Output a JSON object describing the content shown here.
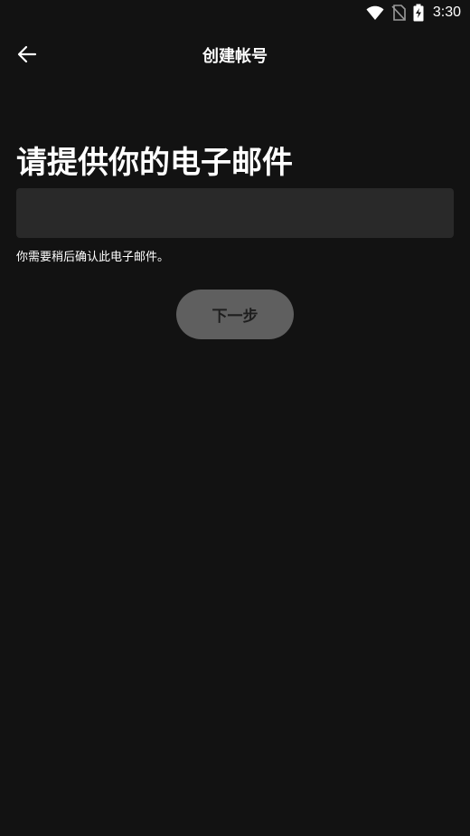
{
  "status_bar": {
    "time": "3:30",
    "icons": [
      "wifi-icon",
      "no-sim-icon",
      "battery-charging-icon"
    ]
  },
  "app_bar": {
    "title": "创建帐号",
    "back_icon": "arrow-left-icon"
  },
  "main": {
    "heading": "请提供你的电子邮件",
    "email_input": {
      "value": "",
      "placeholder": ""
    },
    "helper_text": "你需要稍后确认此电子邮件。",
    "next_button_label": "下一步"
  },
  "colors": {
    "background": "#121212",
    "input_background": "#292929",
    "button_disabled": "#5f5f5f"
  }
}
